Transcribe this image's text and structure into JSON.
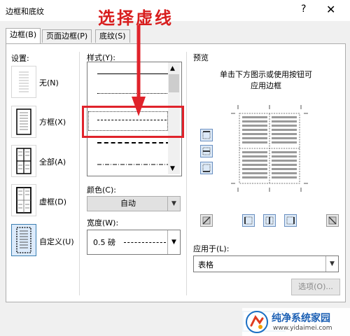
{
  "dialog": {
    "title": "边框和底纹",
    "help": "?",
    "close": "✕"
  },
  "tabs": [
    {
      "label": "边框(B)"
    },
    {
      "label": "页面边框(P)"
    },
    {
      "label": "底纹(S)"
    }
  ],
  "settings": {
    "header": "设置:",
    "items": [
      {
        "label": "无(N)"
      },
      {
        "label": "方框(X)"
      },
      {
        "label": "全部(A)"
      },
      {
        "label": "虚框(D)"
      },
      {
        "label": "自定义(U)"
      }
    ],
    "selected": "自定义(U)"
  },
  "style": {
    "header": "样式(Y):",
    "options": [
      "solid",
      "dotted",
      "dashed-fine",
      "dashed",
      "dash-dot"
    ],
    "selected": "dashed-fine"
  },
  "color": {
    "label": "颜色(C):",
    "value": "自动"
  },
  "width": {
    "label": "宽度(W):",
    "value": "0.5 磅",
    "line_style": "dashed"
  },
  "preview": {
    "header": "预览",
    "hint_line1": "单击下方图示或使用按钮可",
    "hint_line2": "应用边框"
  },
  "apply_to": {
    "label": "应用于(L):",
    "value": "表格"
  },
  "options_button": "选项(O)...",
  "annotation": {
    "text": "选择虚线",
    "color": "#d81e1e"
  },
  "watermark": {
    "brand": "纯净系统家园",
    "url": "www.yidaimei.com"
  }
}
